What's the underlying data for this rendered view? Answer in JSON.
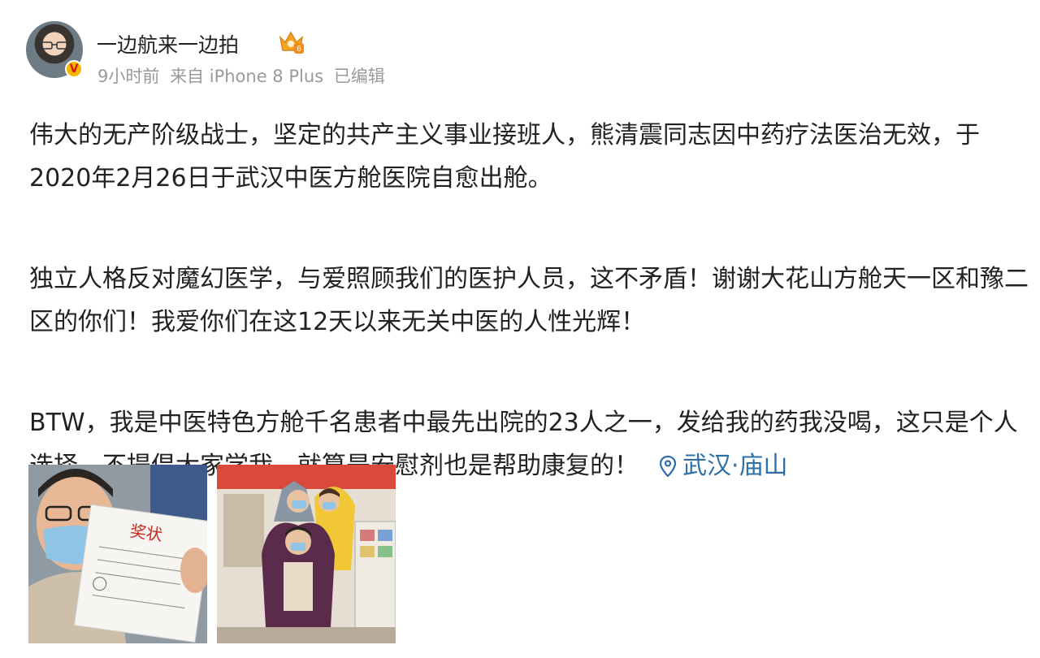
{
  "user": {
    "name": "一边航来一边拍",
    "verified_badge": "V",
    "member_badge_level": "6"
  },
  "meta": {
    "time": "9小时前",
    "source": "来自 iPhone 8 Plus",
    "edited": "已编辑"
  },
  "post": {
    "paragraphs": [
      "伟大的无产阶级战士，坚定的共产主义事业接班人，熊清震同志因中药疗法医治无效，于2020年2月26日于武汉中医方舱医院自愈出舱。",
      "独立人格反对魔幻医学，与爱照顾我们的医护人员，这不矛盾！谢谢大花山方舱天一区和豫二区的你们！我爱你们在这12天以来无关中医的人性光辉！",
      "BTW，我是中医特色方舱千名患者中最先出院的23人之一，发给我的药我没喝，这只是个人选择，不提倡大家学我，就算是安慰剂也是帮助康复的！"
    ],
    "location": "武汉·庙山"
  },
  "photos": {
    "photo1_caption": "奖状",
    "photo_count": 2
  },
  "colors": {
    "link": "#2f6fa8",
    "meta_text": "#9a9a9a",
    "body_text": "#222222"
  }
}
